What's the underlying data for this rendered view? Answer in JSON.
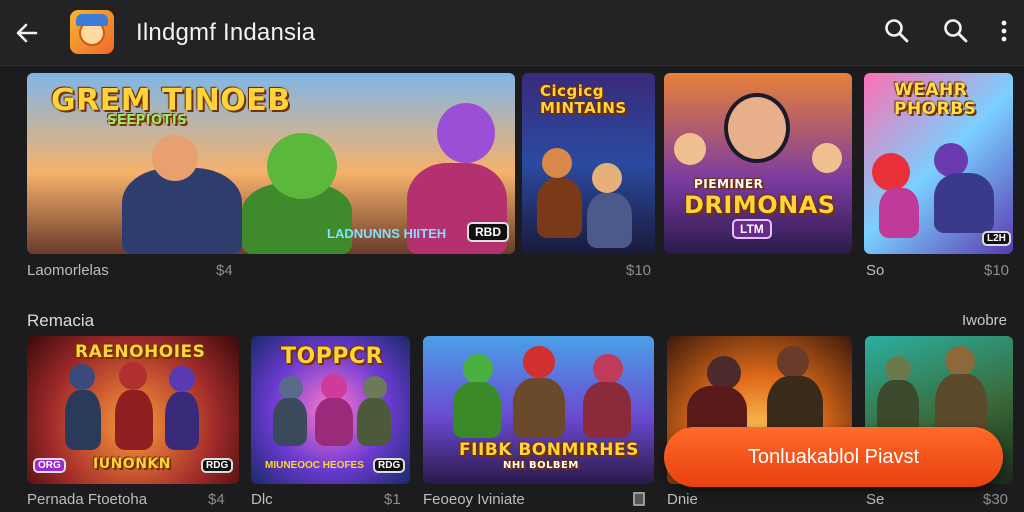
{
  "appbar": {
    "title": "Ilndgmf Indansia",
    "icons": [
      "back-arrow-icon",
      "app-logo-icon",
      "search-icon",
      "search-icon",
      "more-vert-icon"
    ]
  },
  "featured": [
    {
      "wordmark": "GREM TINOEB",
      "sub": "SEEPIOTIS",
      "strip": "LADNUNNS HIITEH",
      "badge": "RBD",
      "label": "Laomorlelas",
      "price": "$4"
    },
    {
      "wordmark": "Cicgicg MINTAINS",
      "label": "",
      "price": "$10"
    },
    {
      "wordmark": "DRIMONAS",
      "top": "PIEMINER",
      "badge": "LTM",
      "label": "",
      "price": ""
    },
    {
      "wordmark": "WEAHR PHORBS",
      "badge": "L2H",
      "label": "So",
      "price": "$10"
    }
  ],
  "section": {
    "title": "Remacia",
    "more": "Iwobre"
  },
  "row": [
    {
      "wordmark": "RAENOHOIES",
      "strip": "IUNONKN",
      "badge_left": "ORG",
      "badge_right": "RDG",
      "label": "Pernada Ftoetoha",
      "price": "$4"
    },
    {
      "wordmark": "TOPPCR",
      "strip": "MIUNEOOC HEOFES",
      "badge": "RDG",
      "label": "Dlc",
      "price": "$1"
    },
    {
      "wordmark": "FIIBK BONMIRHES",
      "sub": "NHI BOLBEM",
      "label": "Feoeoy Iviniate",
      "price": ""
    },
    {
      "label": "Dnie",
      "price": ""
    },
    {
      "label": "Se",
      "price": "$30"
    }
  ],
  "cta": {
    "label": "Tonluakablol Piavst"
  },
  "colors": {
    "background": "#1c1c1e",
    "appbar": "#232325",
    "cta": "#f0521a",
    "wordmark": "#ffd43b"
  }
}
